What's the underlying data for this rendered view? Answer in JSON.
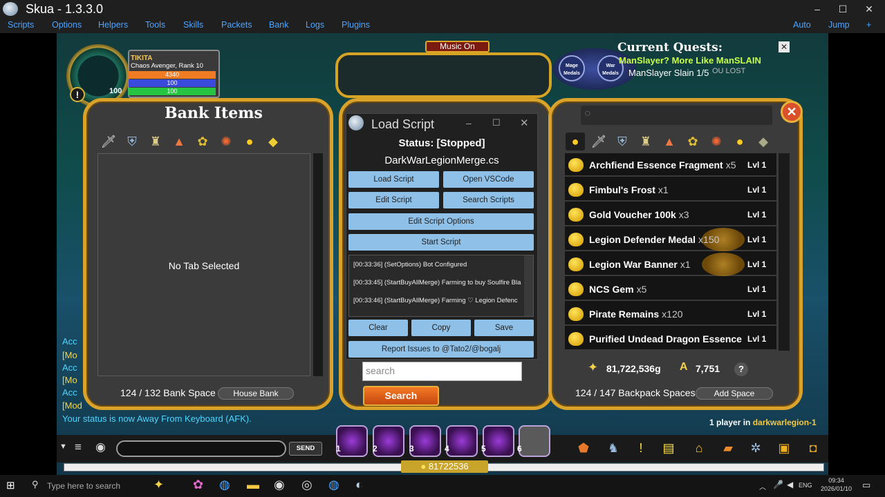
{
  "window": {
    "title": "Skua - 1.3.3.0",
    "minimize": "–",
    "maximize": "☐",
    "close": "✕"
  },
  "menu": {
    "items": [
      "Scripts",
      "Options",
      "Helpers",
      "Tools",
      "Skills",
      "Packets",
      "Bank",
      "Logs",
      "Plugins"
    ],
    "right": [
      "Auto",
      "Jump",
      "+"
    ]
  },
  "player": {
    "name": "TIKITA",
    "class": "Chaos Avenger, Rank 10",
    "hp": "4340",
    "mp": "100",
    "sp": "100",
    "level": "100",
    "warn": "!"
  },
  "music": {
    "label": "Music On"
  },
  "quests": {
    "header": "Current Quests:",
    "line1": "ManSlayer? More Like ManSLAIN",
    "line2": "ManSlayer Slain 1/5",
    "overlay": "OU LOST",
    "close": "✕",
    "medals": [
      "Mage Medals",
      "War Medals"
    ]
  },
  "bank": {
    "title": "Bank Items",
    "empty": "No Tab Selected",
    "space_used": "124",
    "space_total": "132",
    "space_label": "Bank Space",
    "house_bank": "House Bank"
  },
  "dialog": {
    "title": "Load Script",
    "status": "Status: [Stopped]",
    "file": "DarkWarLegionMerge.cs",
    "buttons": {
      "load": "Load Script",
      "open_vscode": "Open VSCode",
      "edit": "Edit Script",
      "search": "Search Scripts",
      "options": "Edit Script Options",
      "start": "Start Script",
      "clear": "Clear",
      "copy": "Copy",
      "save": "Save",
      "report": "Report Issues to @Tato2/@bogalj"
    },
    "log": [
      "[00:33:36] (SetOptions)  Bot Configured",
      "[00:33:45] (StartBuyAllMerge)  Farming to buy Soulfire Bla",
      "[00:33:46] (StartBuyAllMerge)  Farming ♡ Legion Defenc"
    ]
  },
  "search": {
    "placeholder": "search",
    "button": "Search"
  },
  "backpack": {
    "items": [
      {
        "name": "Archfiend Essence Fragment",
        "qty": "x5",
        "lvl": "Lvl 1"
      },
      {
        "name": "Fimbul's Frost",
        "qty": "x1",
        "lvl": "Lvl 1"
      },
      {
        "name": "Gold Voucher 100k",
        "qty": "x3",
        "lvl": "Lvl 1"
      },
      {
        "name": "Legion Defender Medal",
        "qty": "x150",
        "lvl": "Lvl 1",
        "ac": true
      },
      {
        "name": "Legion War Banner",
        "qty": "x1",
        "lvl": "Lvl 1",
        "ac": true
      },
      {
        "name": "NCS Gem",
        "qty": "x5",
        "lvl": "Lvl 1"
      },
      {
        "name": "Pirate Remains",
        "qty": "x120",
        "lvl": "Lvl 1"
      },
      {
        "name": "Purified Undead Dragon Essence",
        "qty": "",
        "lvl": "Lvl 1"
      }
    ],
    "gold": "81,722,536g",
    "ac": "7,751",
    "help": "?",
    "space_used": "124",
    "space_total": "147",
    "space_label": "Backpack Spaces",
    "add_space": "Add Space"
  },
  "chat": {
    "lines": [
      "Acc",
      "[Mo",
      "Acc",
      "[Mo",
      "Acc",
      "[Mod"
    ],
    "away": "Your status is now Away From Keyboard (AFK).",
    "send": "SEND"
  },
  "online": {
    "prefix": "1 player in ",
    "room": "darkwarlegion-1"
  },
  "skills": [
    "1",
    "2",
    "3",
    "4",
    "5",
    "6"
  ],
  "gold_bar": "81722536",
  "taskbar": {
    "search": "Type here to search",
    "lang": "ENG",
    "time": "09:34",
    "date": "2026/01/10"
  }
}
